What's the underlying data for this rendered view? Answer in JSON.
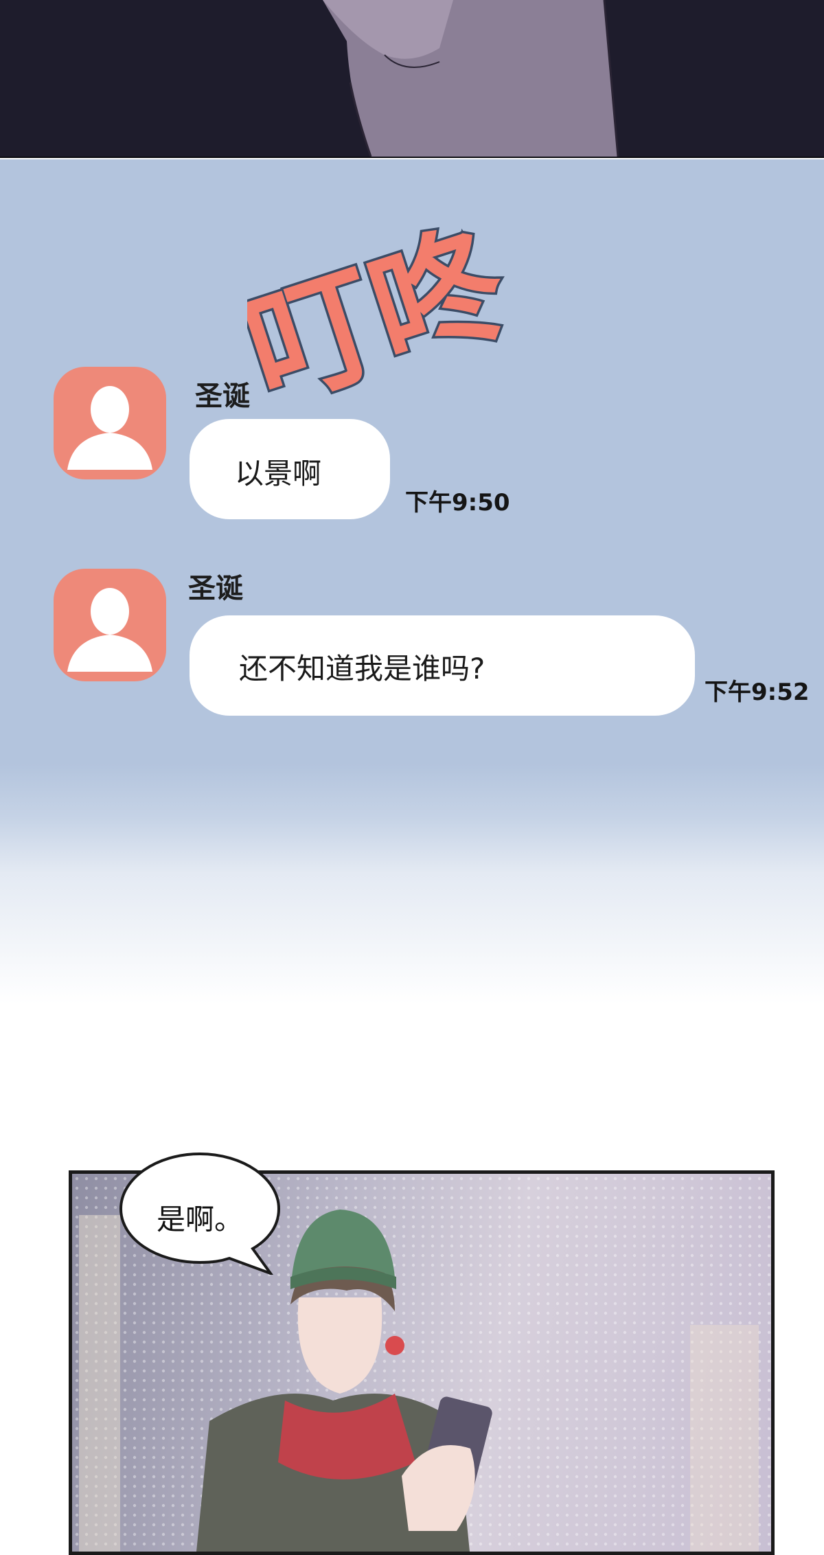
{
  "sfx": {
    "text": "叮咚"
  },
  "messages": [
    {
      "sender": "圣诞",
      "text": "以景啊",
      "time": "下午9:50"
    },
    {
      "sender": "圣诞",
      "text": "还不知道我是谁吗?",
      "time": "下午9:52"
    }
  ],
  "dialogue": {
    "text": "是啊。"
  },
  "colors": {
    "chat_background": "#b3c4dd",
    "avatar": "#ee8979",
    "sfx_fill": "#f37d6c",
    "sfx_outline": "#3b4c66",
    "bubble": "#ffffff"
  }
}
